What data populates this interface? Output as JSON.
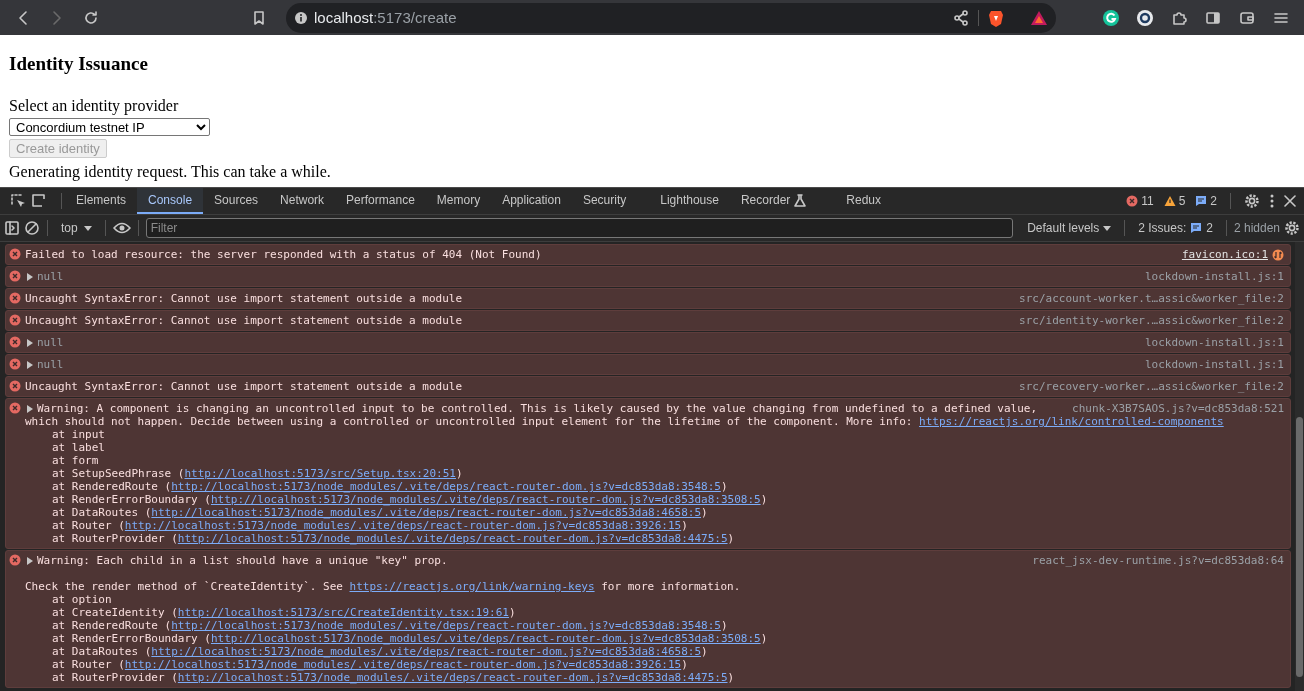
{
  "browser": {
    "url_host": "localhost",
    "url_path": ":5173/create"
  },
  "page": {
    "heading": "Identity Issuance",
    "select_label": "Select an identity provider",
    "select_value": "Concordium testnet IP",
    "button": {
      "label": "Create identity",
      "disabled": true
    },
    "status": "Generating identity request. This can take a while."
  },
  "devtools": {
    "tabs": [
      {
        "label": "Elements",
        "selected": false,
        "experimental": false
      },
      {
        "label": "Console",
        "selected": true,
        "experimental": false
      },
      {
        "label": "Sources",
        "selected": false,
        "experimental": false
      },
      {
        "label": "Network",
        "selected": false,
        "experimental": false
      },
      {
        "label": "Performance",
        "selected": false,
        "experimental": false
      },
      {
        "label": "Memory",
        "selected": false,
        "experimental": false
      },
      {
        "label": "Application",
        "selected": false,
        "experimental": false
      },
      {
        "label": "Security",
        "selected": false,
        "experimental": false
      },
      {
        "label": "Lighthouse",
        "selected": false,
        "experimental": false
      },
      {
        "label": "Recorder",
        "selected": false,
        "experimental": true
      },
      {
        "label": "Redux",
        "selected": false,
        "experimental": false
      }
    ],
    "error_count": "11",
    "warning_count": "5",
    "message_count": "2",
    "context": "top",
    "filter_placeholder": "Filter",
    "levels": "Default levels",
    "issues_label": "2 Issues:",
    "issues_count": "2",
    "hidden": "2 hidden"
  },
  "messages": [
    {
      "kind": "error",
      "expandable": false,
      "text": "Failed to load resource: the server responded with a status of 404 (Not Found)",
      "source": "favicon.ico:1",
      "source_link": true
    },
    {
      "kind": "object",
      "expandable": true,
      "text": "null",
      "source": "lockdown-install.js:1",
      "source_link": false
    },
    {
      "kind": "error",
      "expandable": false,
      "text": "Uncaught SyntaxError: Cannot use import statement outside a module",
      "source": "src/account-worker.t…assic&worker_file:2",
      "source_link": false
    },
    {
      "kind": "error",
      "expandable": false,
      "text": "Uncaught SyntaxError: Cannot use import statement outside a module",
      "source": "src/identity-worker.…assic&worker_file:2",
      "source_link": false
    },
    {
      "kind": "object",
      "expandable": true,
      "text": "null",
      "source": "lockdown-install.js:1",
      "source_link": false
    },
    {
      "kind": "object",
      "expandable": true,
      "text": "null",
      "source": "lockdown-install.js:1",
      "source_link": false
    },
    {
      "kind": "error",
      "expandable": false,
      "text": "Uncaught SyntaxError: Cannot use import statement outside a module",
      "source": "src/recovery-worker.…assic&worker_file:2",
      "source_link": false
    },
    {
      "kind": "error",
      "expandable": true,
      "text": "Warning: A component is changing an uncontrolled input to be controlled. This is likely caused by the value changing from undefined to a defined value,",
      "source": "chunk-X3B7SAOS.js?v=dc853da8:521",
      "source_link": false,
      "lines": [
        {
          "kind": "text",
          "prefix": "which should not happen. Decide between using a controlled or uncontrolled input element for the lifetime of the component. More info: ",
          "link": "https://reactjs.org/link/controlled-components"
        },
        {
          "kind": "frame",
          "prefix": "at input"
        },
        {
          "kind": "frame",
          "prefix": "at label"
        },
        {
          "kind": "frame",
          "prefix": "at form"
        },
        {
          "kind": "frame",
          "prefix": "at SetupSeedPhrase (",
          "link": "http://localhost:5173/src/Setup.tsx:20:51",
          "suffix": ")"
        },
        {
          "kind": "frame",
          "prefix": "at RenderedRoute (",
          "link": "http://localhost:5173/node_modules/.vite/deps/react-router-dom.js?v=dc853da8:3548:5",
          "suffix": ")"
        },
        {
          "kind": "frame",
          "prefix": "at RenderErrorBoundary (",
          "link": "http://localhost:5173/node_modules/.vite/deps/react-router-dom.js?v=dc853da8:3508:5",
          "suffix": ")"
        },
        {
          "kind": "frame",
          "prefix": "at DataRoutes (",
          "link": "http://localhost:5173/node_modules/.vite/deps/react-router-dom.js?v=dc853da8:4658:5",
          "suffix": ")"
        },
        {
          "kind": "frame",
          "prefix": "at Router (",
          "link": "http://localhost:5173/node_modules/.vite/deps/react-router-dom.js?v=dc853da8:3926:15",
          "suffix": ")"
        },
        {
          "kind": "frame",
          "prefix": "at RouterProvider (",
          "link": "http://localhost:5173/node_modules/.vite/deps/react-router-dom.js?v=dc853da8:4475:5",
          "suffix": ")"
        }
      ]
    },
    {
      "kind": "error",
      "expandable": true,
      "text": "Warning: Each child in a list should have a unique \"key\" prop.",
      "source": "react_jsx-dev-runtime.js?v=dc853da8:64",
      "source_link": false,
      "lines": [
        {
          "kind": "para",
          "prefix": "Check the render method of `CreateIdentity`. See ",
          "link": "https://reactjs.org/link/warning-keys",
          "suffix": " for more information."
        },
        {
          "kind": "frame",
          "prefix": "at option"
        },
        {
          "kind": "frame",
          "prefix": "at CreateIdentity (",
          "link": "http://localhost:5173/src/CreateIdentity.tsx:19:61",
          "suffix": ")"
        },
        {
          "kind": "frame",
          "prefix": "at RenderedRoute (",
          "link": "http://localhost:5173/node_modules/.vite/deps/react-router-dom.js?v=dc853da8:3548:5",
          "suffix": ")"
        },
        {
          "kind": "frame",
          "prefix": "at RenderErrorBoundary (",
          "link": "http://localhost:5173/node_modules/.vite/deps/react-router-dom.js?v=dc853da8:3508:5",
          "suffix": ")"
        },
        {
          "kind": "frame",
          "prefix": "at DataRoutes (",
          "link": "http://localhost:5173/node_modules/.vite/deps/react-router-dom.js?v=dc853da8:4658:5",
          "suffix": ")"
        },
        {
          "kind": "frame",
          "prefix": "at Router (",
          "link": "http://localhost:5173/node_modules/.vite/deps/react-router-dom.js?v=dc853da8:3926:15",
          "suffix": ")"
        },
        {
          "kind": "frame",
          "prefix": "at RouterProvider (",
          "link": "http://localhost:5173/node_modules/.vite/deps/react-router-dom.js?v=dc853da8:4475:5",
          "suffix": ")"
        }
      ]
    }
  ]
}
